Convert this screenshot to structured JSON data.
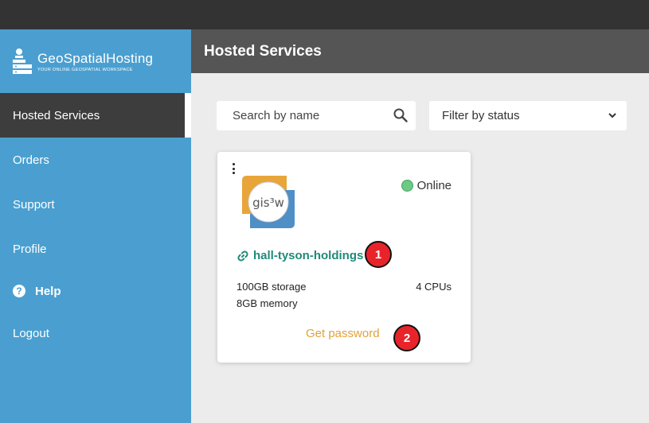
{
  "app": {
    "brand_name": "GeoSpatialHosting",
    "brand_tagline": "YOUR ONLINE GEOSPATIAL WORKSPACE"
  },
  "sidebar": {
    "items": [
      {
        "label": "Hosted Services",
        "active": true
      },
      {
        "label": "Orders"
      },
      {
        "label": "Support"
      },
      {
        "label": "Profile"
      },
      {
        "label": "Help",
        "icon": "question-circle-icon"
      },
      {
        "label": "Logout"
      }
    ]
  },
  "header": {
    "title": "Hosted Services"
  },
  "search": {
    "placeholder": "Search by name",
    "icon": "search-icon"
  },
  "filter": {
    "selected": "Filter by status",
    "icon": "chevron-down-icon"
  },
  "card": {
    "status": "Online",
    "status_color": "#6ccb86",
    "name": "hall-tyson-holdings",
    "storage": "100GB storage",
    "cpus": "4 CPUs",
    "memory": "8GB memory",
    "action_label": "Get password",
    "action_color": "#e0a23a",
    "link_color": "#1f8a7a"
  },
  "annotations": [
    "1",
    "2"
  ],
  "colors": {
    "sidebar": "#4a9fd0",
    "topbar": "#333333",
    "header": "#555555",
    "badge": "#e8242a"
  }
}
